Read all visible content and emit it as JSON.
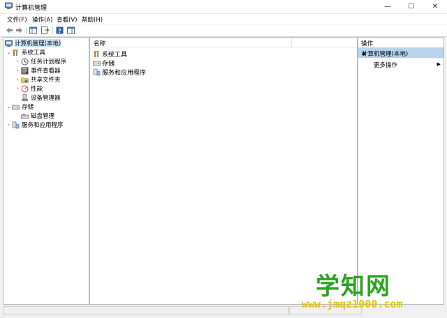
{
  "window": {
    "title": "计算机管理",
    "icon": "computer-management-icon",
    "controls": {
      "minimize": "—",
      "maximize": "☐",
      "close": "✕"
    }
  },
  "menu": {
    "items": [
      {
        "label": "文件(F)"
      },
      {
        "label": "操作(A)"
      },
      {
        "label": "查看(V)"
      },
      {
        "label": "帮助(H)"
      }
    ]
  },
  "toolbar": {
    "icons": [
      "back-arrow-icon",
      "forward-arrow-icon",
      "show-console-tree-icon",
      "export-list-icon",
      "help-icon",
      "show-action-pane-icon"
    ]
  },
  "tree": {
    "root": {
      "label": "计算机管理(本地)",
      "icon": "computer-management-icon"
    },
    "items": [
      {
        "label": "系统工具",
        "icon": "system-tools-icon",
        "expanded": true,
        "level": 1
      },
      {
        "label": "任务计划程序",
        "icon": "task-scheduler-icon",
        "level": 2
      },
      {
        "label": "事件查看器",
        "icon": "event-viewer-icon",
        "level": 2
      },
      {
        "label": "共享文件夹",
        "icon": "shared-folders-icon",
        "level": 2
      },
      {
        "label": "性能",
        "icon": "performance-icon",
        "level": 2
      },
      {
        "label": "设备管理器",
        "icon": "device-manager-icon",
        "level": 2
      },
      {
        "label": "存储",
        "icon": "storage-icon",
        "expanded": true,
        "level": 1
      },
      {
        "label": "磁盘管理",
        "icon": "disk-management-icon",
        "level": 2
      },
      {
        "label": "服务和应用程序",
        "icon": "services-apps-icon",
        "level": 1
      }
    ]
  },
  "center": {
    "column_header": "名称",
    "rows": [
      {
        "label": "系统工具",
        "icon": "system-tools-icon"
      },
      {
        "label": "存储",
        "icon": "storage-icon"
      },
      {
        "label": "服务和应用程序",
        "icon": "services-apps-icon"
      }
    ]
  },
  "actions": {
    "title": "操作",
    "selected": "计算机管理(本地)",
    "more": "更多操作"
  },
  "watermark": {
    "brand": "学知网",
    "url": "www.jmqz1000.com"
  },
  "colors": {
    "selection": "#cce4f7",
    "actions_selected": "#b8d3ec",
    "watermark_green": "#2aa31d",
    "watermark_yellow": "#e7c400"
  }
}
